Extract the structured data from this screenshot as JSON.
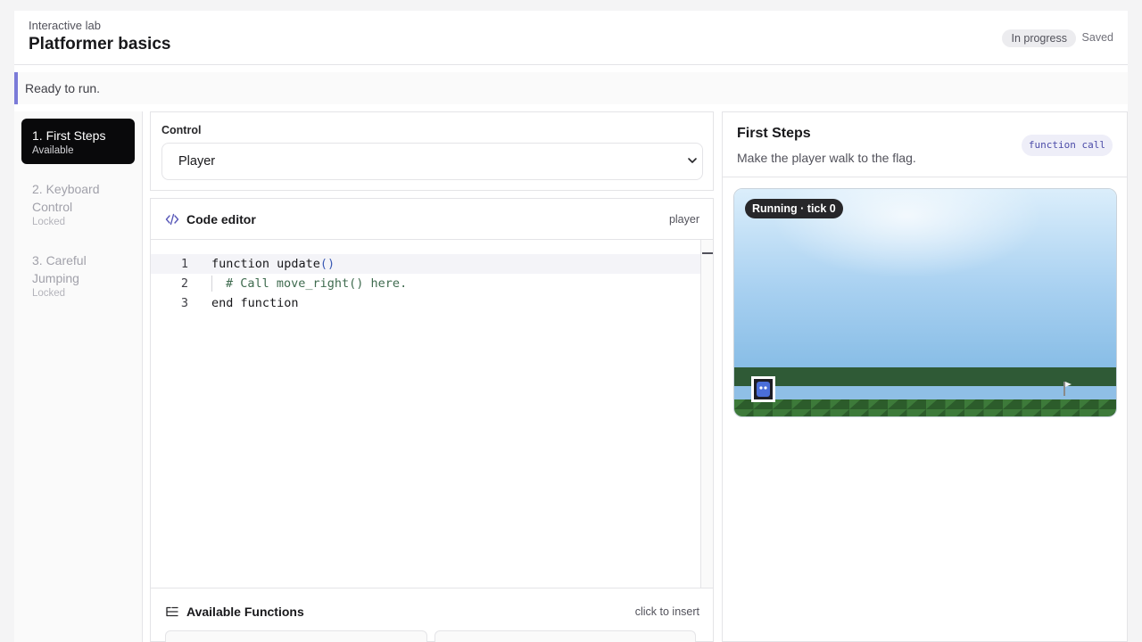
{
  "header": {
    "eyebrow": "Interactive lab",
    "title": "Platformer basics",
    "status_badge": "In progress",
    "save_state": "Saved"
  },
  "status": {
    "message": "Ready to run."
  },
  "sidebar": {
    "lessons": [
      {
        "label": "1. First Steps",
        "state": "Available",
        "active": true
      },
      {
        "label": "2. Keyboard Control",
        "state": "Locked",
        "active": false
      },
      {
        "label": "3. Careful Jumping",
        "state": "Locked",
        "active": false
      }
    ]
  },
  "control": {
    "label": "Control",
    "selected": "Player"
  },
  "editor": {
    "title": "Code editor",
    "target": "player",
    "lines": [
      {
        "num": "1",
        "code": "function update",
        "paren": "()"
      },
      {
        "num": "2",
        "comment": "# Call move_right() here."
      },
      {
        "num": "3",
        "code": "end function"
      }
    ]
  },
  "functions": {
    "title": "Available Functions",
    "hint": "click to insert"
  },
  "preview": {
    "title": "First Steps",
    "description": "Make the player walk to the flag.",
    "concept_chip": "function call",
    "run_status": "Running · tick 0"
  },
  "colors": {
    "accent": "#7b7bd8",
    "active_lesson": "#09090b",
    "grass": "#2f5a36",
    "sky": "#8fbfe6"
  },
  "icons": [
    "code-icon",
    "list-icon",
    "chevron-down-icon",
    "flag-icon",
    "player-sprite"
  ]
}
